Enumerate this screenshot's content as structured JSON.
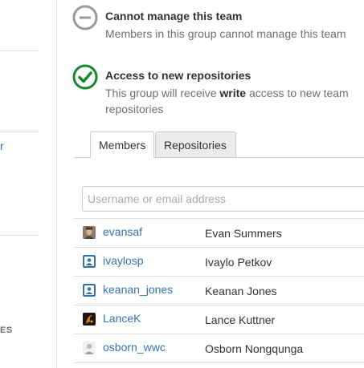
{
  "permissions": {
    "manage": {
      "title": "Cannot manage this team",
      "description": "Members in this group cannot manage this team",
      "icon": "no-entry-icon"
    },
    "access": {
      "title": "Access to new repositories",
      "description_prefix": "This group will receive ",
      "description_strong": "write",
      "description_suffix": " access to new team repositories",
      "icon": "check-circle-icon"
    }
  },
  "tabs": [
    {
      "label": "Members",
      "active": true
    },
    {
      "label": "Repositories",
      "active": false
    }
  ],
  "search": {
    "placeholder": "Username or email address"
  },
  "members": [
    {
      "username": "evansaf",
      "name": "Evan Summers",
      "avatar": "photo-avatar-icon"
    },
    {
      "username": "ivaylosp",
      "name": "Ivaylo Petkov",
      "avatar": "default-user-avatar-icon"
    },
    {
      "username": "keanan_jones",
      "name": "Keanan Jones",
      "avatar": "default-user-avatar-icon"
    },
    {
      "username": "LanceK",
      "name": "Lance Kuttner",
      "avatar": "dark-pattern-avatar-icon"
    },
    {
      "username": "osborn_wwc",
      "name": "Osborn Nongqunga",
      "avatar": "grey-face-avatar-icon"
    }
  ],
  "left_fragments": {
    "link": "r",
    "heading": "ES"
  },
  "colors": {
    "link": "#3572b0",
    "success": "#14892c",
    "muted": "#999999"
  }
}
